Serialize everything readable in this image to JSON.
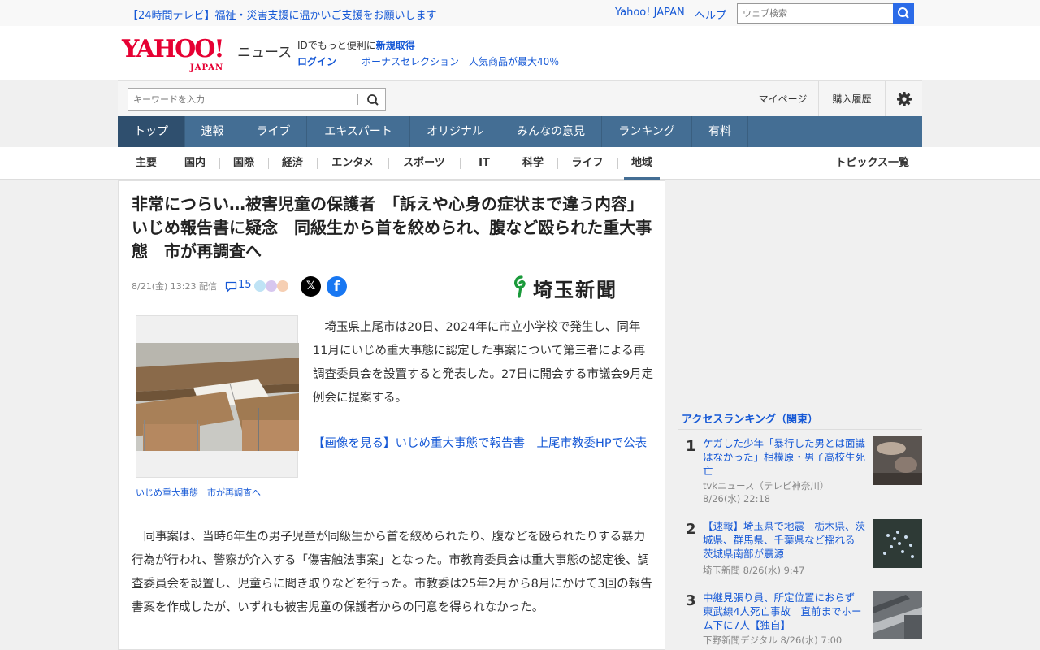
{
  "topbar": {
    "promo": "【24時間テレビ】福祉・災害支援に温かいご支援をお願いします",
    "yahoo_japan": "Yahoo! JAPAN",
    "help": "ヘルプ",
    "web_search_placeholder": "ウェブ検索"
  },
  "header": {
    "logo_main": "YAHOO!",
    "logo_sub": "JAPAN",
    "logo_news": "ニュース",
    "id_prefix": "IDでもっと便利に",
    "id_signup": "新規取得",
    "login": "ログイン",
    "bonus": "ボーナスセレクション　人気商品が最大40％"
  },
  "searchbar": {
    "placeholder": "キーワードを入力",
    "mypage": "マイページ",
    "history": "購入履歴"
  },
  "main_nav": [
    "トップ",
    "速報",
    "ライブ",
    "エキスパート",
    "オリジナル",
    "みんなの意見",
    "ランキング",
    "有料"
  ],
  "sub_nav": [
    "主要",
    "国内",
    "国際",
    "経済",
    "エンタメ",
    "スポーツ",
    "IT",
    "科学",
    "ライフ",
    "地域"
  ],
  "topics_all": "トピックス一覧",
  "article": {
    "headline": "非常につらい…被害児童の保護者　「訴えや心身の症状まで違う内容」　いじめ報告書に疑念　同級生から首を絞められ、腹など殴られた重大事態　市が再調査へ",
    "date": "8/21(金) 13:23",
    "date_suffix": "配信",
    "comments": "15",
    "publisher": "埼玉新聞",
    "x_label": "𝕏",
    "fb_label": "f",
    "photo_caption": "いじめ重大事態　市が再調査へ",
    "lead": "　埼玉県上尾市は20日、2024年に市立小学校で発生し、同年11月にいじめ重大事態に認定した事案について第三者による再調査委員会を設置すると発表した。27日に開会する市議会9月定例会に提案する。",
    "image_link": "【画像を見る】いじめ重大事態で報告書　上尾市教委HPで公表",
    "body": "　同事案は、当時6年生の男子児童が同級生から首を絞められたり、腹などを殴られたりする暴力行為が行われ、警察が介入する「傷害触法事案」となった。市教育委員会は重大事態の認定後、調査委員会を設置し、児童らに聞き取りなどを行った。市教委は25年2月から8月にかけて3回の報告書案を作成したが、いずれも被害児童の保護者からの同意を得られなかった。"
  },
  "ranking": {
    "title": "アクセスランキング（関東）",
    "items": [
      {
        "num": "1",
        "headline": "ケガした少年「暴行した男とは面識はなかった」相模原・男子高校生死亡",
        "source": "tvkニュース（テレビ神奈川）",
        "date": "8/26(水) 22:18"
      },
      {
        "num": "2",
        "headline": "【速報】埼玉県で地震　栃木県、茨城県、群馬県、千葉県など揺れる　茨城県南部が震源",
        "source": "埼玉新聞",
        "date": "8/26(水) 9:47"
      },
      {
        "num": "3",
        "headline": "中継見張り員、所定位置におらず　東武線4人死亡事故　直前までホーム下に7人【独自】",
        "source": "下野新聞デジタル",
        "date": "8/26(水) 7:00"
      }
    ]
  },
  "colors": {
    "link": "#1558d6",
    "brand_red": "#e60033",
    "nav_bg": "#446e94",
    "nav_active": "#2f4f6e"
  }
}
